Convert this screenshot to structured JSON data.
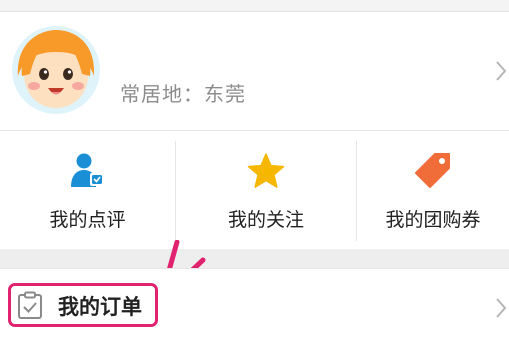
{
  "profile": {
    "residence_text": "常居地：东莞"
  },
  "shortcuts": [
    {
      "label": "我的点评",
      "icon": "user-review-icon",
      "color": "#1b8fd6"
    },
    {
      "label": "我的关注",
      "icon": "star-icon",
      "color": "#f5b700"
    },
    {
      "label": "我的团购券",
      "icon": "tag-icon",
      "color": "#f06d3a"
    }
  ],
  "orders": {
    "label": "我的订单",
    "icon": "clipboard-check-icon",
    "highlight_color": "#e0226f"
  }
}
